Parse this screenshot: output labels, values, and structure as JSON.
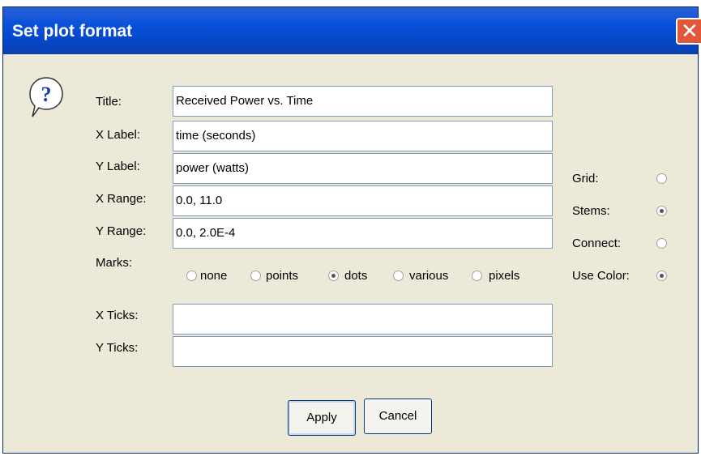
{
  "window": {
    "title": "Set plot format"
  },
  "icons": {
    "close": "close-icon",
    "help": "question-icon"
  },
  "fields": {
    "title": {
      "label": "Title:",
      "value": "Received Power vs. Time"
    },
    "xlabel": {
      "label": "X Label:",
      "value": "time (seconds)"
    },
    "ylabel": {
      "label": "Y Label:",
      "value": "power (watts)"
    },
    "xrange": {
      "label": "X Range:",
      "value": "0.0, 11.0"
    },
    "yrange": {
      "label": "Y Range:",
      "value": "0.0, 2.0E-4"
    },
    "xticks": {
      "label": "X Ticks:",
      "value": ""
    },
    "yticks": {
      "label": "Y Ticks:",
      "value": ""
    }
  },
  "marks": {
    "label": "Marks:",
    "options": [
      {
        "label": "none",
        "checked": false
      },
      {
        "label": "points",
        "checked": false
      },
      {
        "label": "dots",
        "checked": true
      },
      {
        "label": "various",
        "checked": false
      },
      {
        "label": "pixels",
        "checked": false
      }
    ]
  },
  "options": {
    "grid": {
      "label": "Grid:",
      "checked": false
    },
    "stems": {
      "label": "Stems:",
      "checked": true
    },
    "connect": {
      "label": "Connect:",
      "checked": false
    },
    "use_color": {
      "label": "Use Color:",
      "checked": true
    }
  },
  "buttons": {
    "apply": "Apply",
    "cancel": "Cancel"
  },
  "colors": {
    "titlebar": "#0a51dc",
    "dialog_bg": "#ece9d8",
    "close": "#e0573c"
  }
}
